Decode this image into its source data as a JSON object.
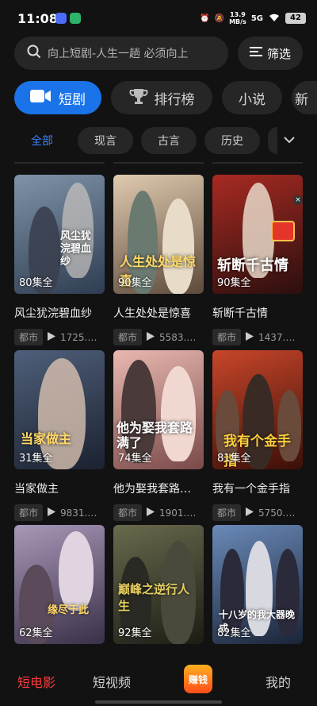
{
  "status": {
    "time": "11:08",
    "speed_val": "13.9",
    "speed_unit": "MB/s",
    "network": "5G",
    "battery": "42"
  },
  "search": {
    "placeholder": "向上短剧-人生一趟 必须向上",
    "search_icon": "search-icon"
  },
  "filter": {
    "label": "筛选",
    "icon": "filter-icon"
  },
  "primary_tabs": [
    {
      "label": "短剧",
      "icon": "video-icon",
      "active": true
    },
    {
      "label": "排行榜",
      "icon": "trophy-icon"
    },
    {
      "label": "小说"
    },
    {
      "label": "新"
    }
  ],
  "chips": [
    "全部",
    "现言",
    "古言",
    "历史"
  ],
  "dramas": [
    {
      "title": "风尘犹浣碧血纱",
      "episodes": "80集全",
      "tag": "都市",
      "views": "1725.…",
      "poster_text": "风尘犹浣碧血纱",
      "colors": [
        "#6a7f96",
        "#2f3d52"
      ]
    },
    {
      "title": "人生处处是惊喜",
      "episodes": "90集全",
      "tag": "都市",
      "views": "5583.…",
      "poster_text": "人生处处是惊喜",
      "colors": [
        "#c9b08f",
        "#5d4a3a"
      ]
    },
    {
      "title": "斩断千古情",
      "episodes": "90集全",
      "tag": "都市",
      "views": "1437.…",
      "poster_text": "斩断千古情",
      "colors": [
        "#8a1c1c",
        "#2b0f0f"
      ]
    },
    {
      "title": "当家做主",
      "episodes": "31集全",
      "tag": "都市",
      "views": "9831.…",
      "poster_text": "当家做主",
      "colors": [
        "#3f4d66",
        "#1b2230"
      ]
    },
    {
      "title": "他为娶我套路…",
      "episodes": "74集全",
      "tag": "都市",
      "views": "1901.…",
      "poster_text": "他为娶我套路满了",
      "colors": [
        "#d9a3a0",
        "#7a4a4a"
      ]
    },
    {
      "title": "我有一个金手指",
      "episodes": "81集全",
      "tag": "都市",
      "views": "5750.…",
      "poster_text": "我有个金手指",
      "colors": [
        "#b33a1f",
        "#3a0f08"
      ]
    },
    {
      "title": "",
      "episodes": "62集全",
      "tag": "",
      "views": "",
      "poster_text": "缘尽于此",
      "colors": [
        "#8a7a9a",
        "#3a3048"
      ]
    },
    {
      "title": "",
      "episodes": "92集全",
      "tag": "",
      "views": "",
      "poster_text": "巅峰之逆行人生",
      "colors": [
        "#4a4a38",
        "#1c1c14"
      ]
    },
    {
      "title": "",
      "episodes": "82集全",
      "tag": "",
      "views": "",
      "poster_text": "十八岁的我大器晚成",
      "colors": [
        "#4a6a9a",
        "#1a2438"
      ]
    }
  ],
  "bottom_nav": {
    "short_movie": "短电影",
    "short_video": "短视频",
    "earn": "赚钱",
    "mine": "我的"
  }
}
